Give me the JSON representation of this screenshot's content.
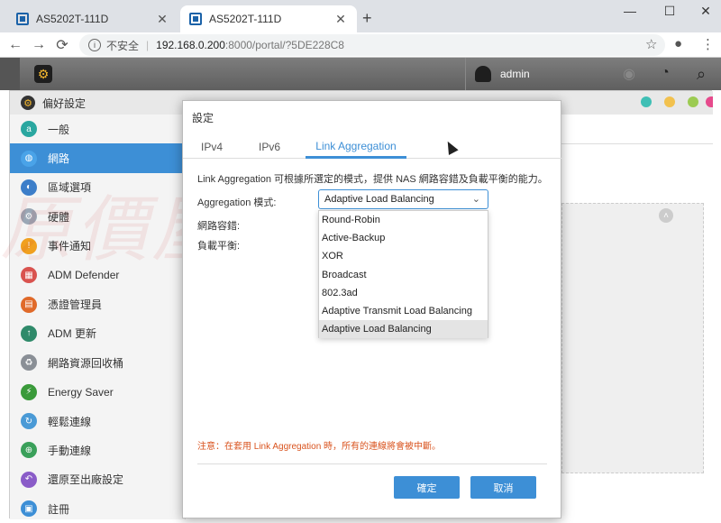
{
  "browser": {
    "tabs": [
      {
        "title": "AS5202T-111D",
        "close": "✕"
      },
      {
        "title": "AS5202T-111D",
        "close": "✕"
      }
    ],
    "new_tab": "+",
    "window_controls": {
      "minimize": "—",
      "maximize": "☐",
      "close": "✕"
    },
    "nav": {
      "back": "←",
      "forward": "→",
      "reload": "⟳"
    },
    "address": {
      "info": "i",
      "security_label": "不安全",
      "separator": "|",
      "host": "192.168.0.200",
      "path": ":8000/portal/?5DE228C8"
    },
    "toolbar_icons": {
      "star": "☆",
      "profile": "●",
      "menu": "⋮"
    }
  },
  "adm": {
    "gear": "⚙",
    "username": "admin",
    "icons": {
      "activity": "◉",
      "dashboard": "◔",
      "search": "⌕"
    }
  },
  "prefs": {
    "title": "偏好設定",
    "gear": "⚙",
    "dots": {
      "teal": "#3fbfb5",
      "yellow": "#f2c14e",
      "green": "#9ccb52",
      "pink": "#e64a8c"
    },
    "sidebar": [
      {
        "label": "一般",
        "color": "#2aa7a0",
        "glyph": "a"
      },
      {
        "label": "網路",
        "color": "#4aa3e8",
        "glyph": "◍"
      },
      {
        "label": "區域選項",
        "color": "#3c7ec9",
        "glyph": "◐"
      },
      {
        "label": "硬體",
        "color": "#9aa7b5",
        "glyph": "⚙"
      },
      {
        "label": "事件通知",
        "color": "#f0a020",
        "glyph": "!"
      },
      {
        "label": "ADM Defender",
        "color": "#d9534f",
        "glyph": "▦"
      },
      {
        "label": "憑證管理員",
        "color": "#e06a2a",
        "glyph": "▤"
      },
      {
        "label": "ADM 更新",
        "color": "#2f8a6a",
        "glyph": "↑"
      },
      {
        "label": "網路資源回收桶",
        "color": "#8a8f96",
        "glyph": "♻"
      },
      {
        "label": "Energy Saver",
        "color": "#3a9a3a",
        "glyph": "⚡"
      },
      {
        "label": "輕鬆連線",
        "color": "#4a9ad6",
        "glyph": "↻"
      },
      {
        "label": "手動連線",
        "color": "#3aa05a",
        "glyph": "⊕"
      },
      {
        "label": "還原至出廠設定",
        "color": "#8a5cc8",
        "glyph": "↶"
      },
      {
        "label": "註冊",
        "color": "#3d8fd6",
        "glyph": "▣"
      }
    ],
    "collapse": "˄",
    "watermark": "原價屋C∞lpc"
  },
  "dialog": {
    "title": "設定",
    "tabs": [
      "IPv4",
      "IPv6",
      "Link Aggregation"
    ],
    "description": "Link Aggregation 可根據所選定的模式，提供 NAS 網路容錯及負載平衡的能力。",
    "mode_label": "Aggregation 模式:",
    "failover_label": "網路容錯:",
    "balance_label": "負載平衡:",
    "selected_mode": "Adaptive Load Balancing",
    "chevron": "⌄",
    "options": [
      "Round-Robin",
      "Active-Backup",
      "XOR",
      "Broadcast",
      "802.3ad",
      "Adaptive Transmit Load Balancing",
      "Adaptive Load Balancing"
    ],
    "notice": "注意：在套用 Link Aggregation 時，所有的連線將會被中斷。",
    "ok_label": "確定",
    "cancel_label": "取消"
  }
}
